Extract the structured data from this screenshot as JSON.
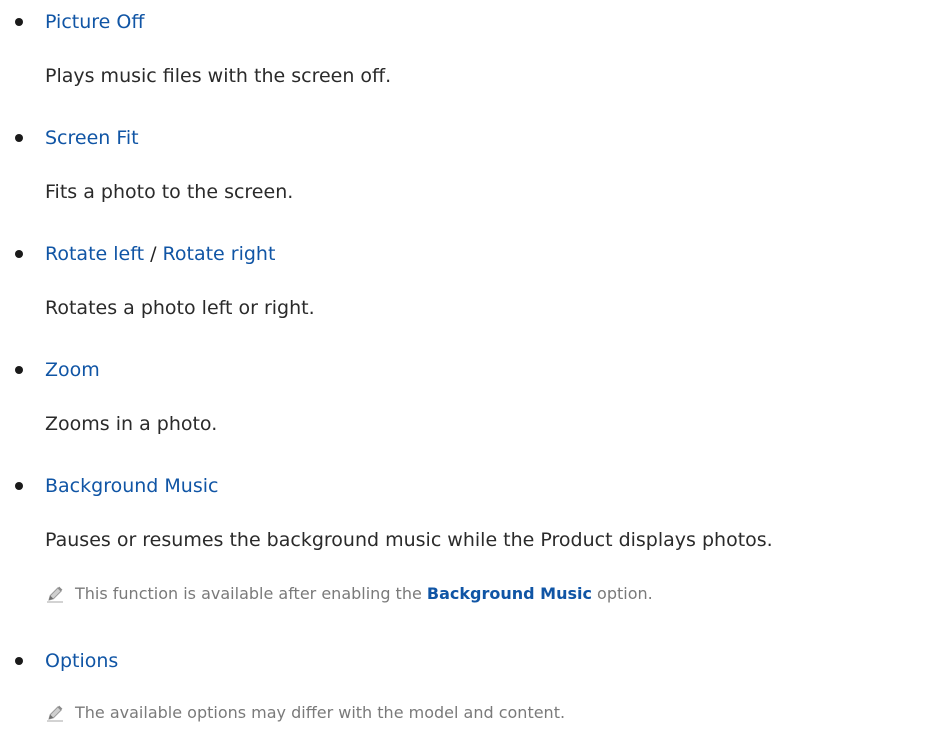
{
  "items": [
    {
      "title": "Picture Off",
      "description": "Plays music files with the screen off."
    },
    {
      "title": "Screen Fit",
      "description": "Fits a photo to the screen."
    },
    {
      "title_part1": "Rotate left",
      "title_separator": " / ",
      "title_part2": "Rotate right",
      "description": "Rotates a photo left or right."
    },
    {
      "title": "Zoom",
      "description": "Zooms in a photo."
    },
    {
      "title": "Background Music",
      "description": "Pauses or resumes the background music while the Product displays photos.",
      "note_before": "This function is available after enabling the ",
      "note_highlight": "Background Music",
      "note_after": " option."
    },
    {
      "title": "Options",
      "note": "The available options may differ with the model and content."
    }
  ],
  "colors": {
    "link": "#1055a5",
    "body_text": "#2a2a2a",
    "note_text": "#7a7a7a",
    "bullet": "#1a1a1a"
  },
  "icons": {
    "note_icon": "pencil-note-icon"
  }
}
